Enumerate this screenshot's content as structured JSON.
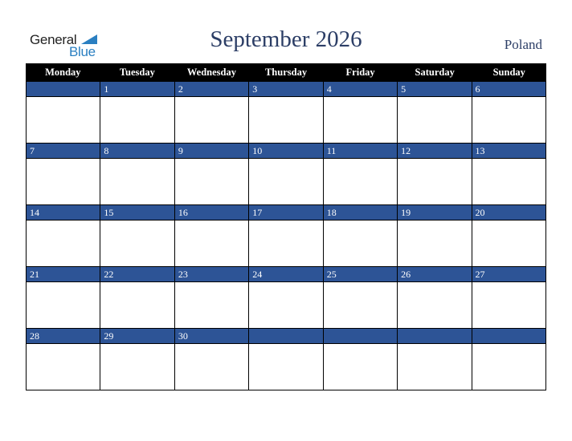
{
  "logo": {
    "word1": "General",
    "word2": "Blue"
  },
  "title": "September 2026",
  "country": "Poland",
  "colors": {
    "header_bg": "#000000",
    "date_bar": "#2d5496",
    "title": "#2c3e66",
    "logo_blue": "#2a7fc1"
  },
  "weekdays": [
    "Monday",
    "Tuesday",
    "Wednesday",
    "Thursday",
    "Friday",
    "Saturday",
    "Sunday"
  ],
  "weeks": [
    [
      "",
      "1",
      "2",
      "3",
      "4",
      "5",
      "6"
    ],
    [
      "7",
      "8",
      "9",
      "10",
      "11",
      "12",
      "13"
    ],
    [
      "14",
      "15",
      "16",
      "17",
      "18",
      "19",
      "20"
    ],
    [
      "21",
      "22",
      "23",
      "24",
      "25",
      "26",
      "27"
    ],
    [
      "28",
      "29",
      "30",
      "",
      "",
      "",
      ""
    ]
  ]
}
